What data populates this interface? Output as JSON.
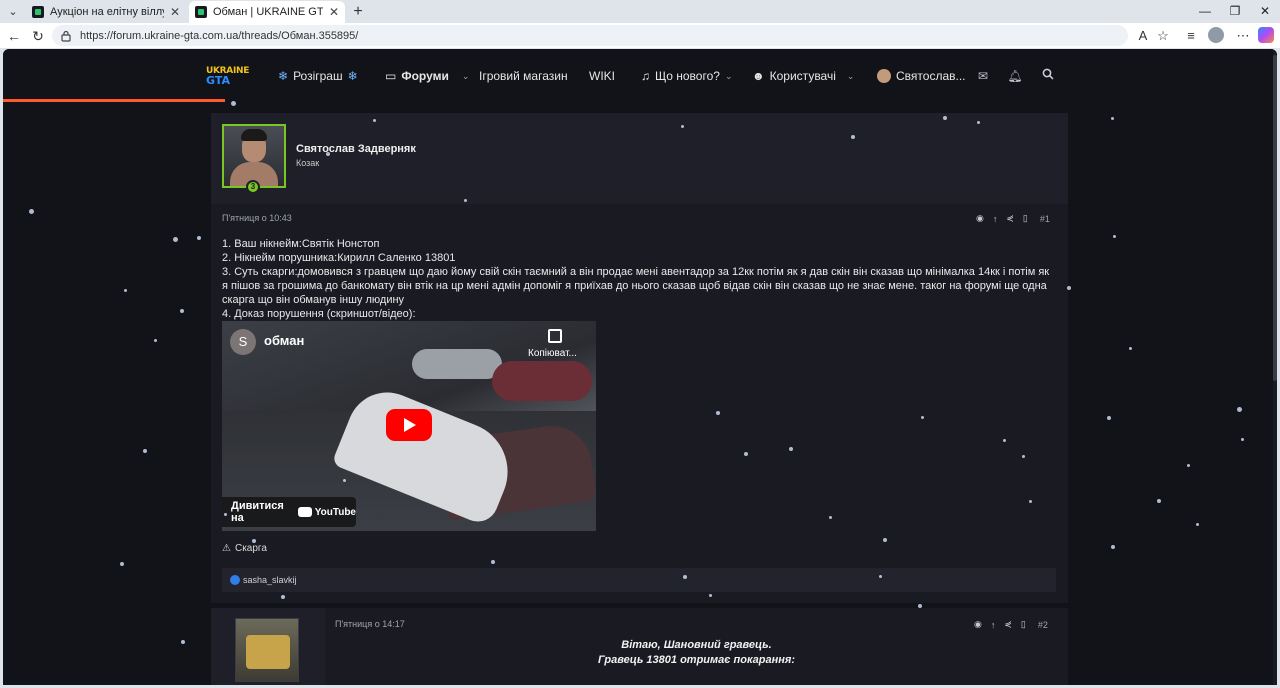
{
  "browser": {
    "tabs": [
      {
        "title": "Аукціон на елітну віллу в Конча"
      },
      {
        "title": "Обман | UKRAINE GTA - Ігровий"
      }
    ],
    "url": "https://forum.ukraine-gta.com.ua/threads/Обман.355895/"
  },
  "site": {
    "logo_top": "UKRAINE",
    "logo_bottom": "GTA",
    "nav": {
      "giveaway": "Розіграш",
      "forums": "Форуми",
      "store": "Ігровий магазин",
      "wiki": "WIKI",
      "whats_new": "Що нового?",
      "users": "Користувачі",
      "account": "Святослав..."
    }
  },
  "post1": {
    "author": "Святослав Задверняк",
    "role": "Козак",
    "level": "3",
    "date": "П'ятниця о 10:43",
    "number": "#1",
    "lines": [
      "1. Ваш нікнейм:Святік Нонстоп",
      "2. Нікнейм порушника:Кирилл Саленко 13801",
      "3. Суть скарги:домовився з гравцем що даю йому свій скін таємний а він продає мені авентадор за 12кк потім як я дав скін він сказав що мінімалка 14кк і потім як я пішов за грошима до банкомату він втік на цр мені адмін допоміг я приїхав до нього сказав щоб відав скін він сказав що не знає мене. таког на форумі ще одна скарга що він обманув іншу людину",
      "4. Доказ порушення (скриншот/відео):"
    ],
    "video": {
      "channel_initial": "S",
      "title": "обман",
      "copy_label": "Копіюват...",
      "watch_on": "Дивитися на",
      "youtube": "YouTube"
    },
    "report": "Скарга",
    "reaction_user": "sasha_slavkij"
  },
  "post2": {
    "date": "П'ятниця о 14:17",
    "number": "#2",
    "greeting": "Вітаю, Шановний гравець.",
    "verdict": "Гравець 13801 отримає покарання:"
  },
  "colors": {
    "accent_progress": "#ff5a2b",
    "avatar_border": "#7cc623",
    "youtube_red": "#ff0000"
  }
}
